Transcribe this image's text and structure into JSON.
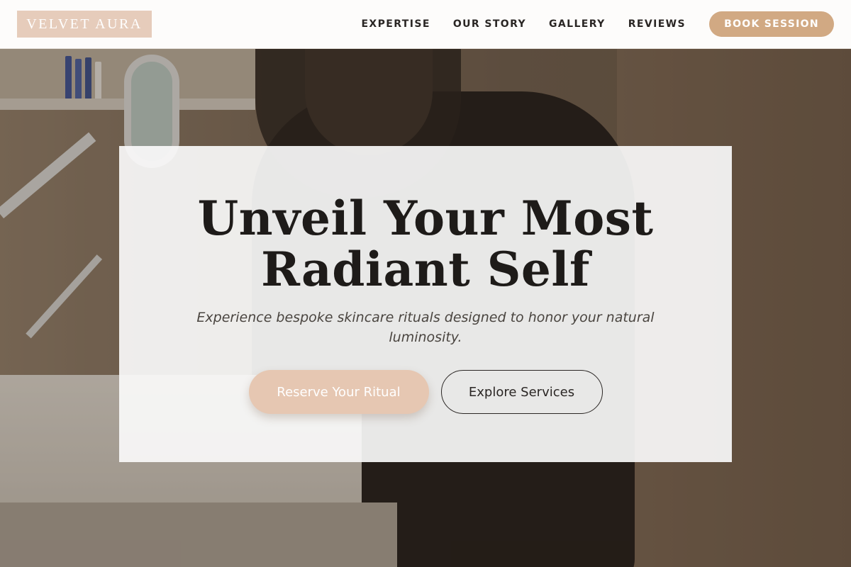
{
  "header": {
    "logo_text": "VELVET AURA",
    "nav": [
      {
        "label": "EXPERTISE"
      },
      {
        "label": "OUR STORY"
      },
      {
        "label": "GALLERY"
      },
      {
        "label": "REVIEWS"
      }
    ],
    "cta_label": "BOOK SESSION"
  },
  "hero": {
    "headline_line1": "Unveil Your Most",
    "headline_line2": "Radiant Self",
    "subtext": "Experience bespoke skincare rituals designed to honor your natural luminosity.",
    "primary_button": "Reserve Your Ritual",
    "secondary_button": "Explore Services"
  },
  "colors": {
    "accent": "#d1a983",
    "logo_bg": "#e6ccbb",
    "primary_button_bg": "#e6c7b2",
    "text_dark": "#1e1b19"
  }
}
